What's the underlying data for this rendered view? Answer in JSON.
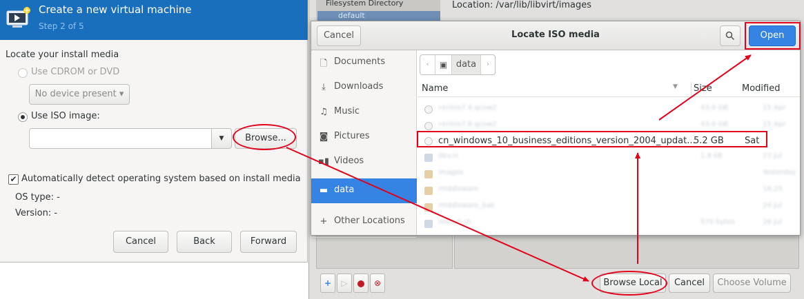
{
  "wizard": {
    "title": "Create a new virtual machine",
    "step": "Step 2 of 5",
    "section_label": "Locate your install media",
    "cdrom_option": "Use CDROM or DVD",
    "cdrom_device": "No device present ▾",
    "iso_option": "Use ISO image:",
    "iso_path": "",
    "browse_button": "Browse...",
    "auto_detect_label": "Automatically detect operating system based on install media",
    "os_type": "OS type: -",
    "version": "Version: -",
    "cancel_button": "Cancel",
    "back_button": "Back",
    "forward_button": "Forward"
  },
  "storage_window": {
    "pool_type": "Filesystem Directory",
    "pool_name": "default",
    "location_label": "Location:",
    "location_path": "/var/lib/libvirt/images",
    "browse_local_button": "Browse Local",
    "cancel_button": "Cancel",
    "choose_volume_button": "Choose Volume"
  },
  "file_chooser": {
    "title": "Locate ISO media",
    "cancel_button": "Cancel",
    "open_button": "Open",
    "places": [
      {
        "label": "Documents",
        "icon": "document-icon"
      },
      {
        "label": "Downloads",
        "icon": "download-icon"
      },
      {
        "label": "Music",
        "icon": "music-icon"
      },
      {
        "label": "Pictures",
        "icon": "camera-icon"
      },
      {
        "label": "Videos",
        "icon": "video-icon"
      },
      {
        "label": "data",
        "icon": "folder-icon"
      },
      {
        "label": "Other Locations",
        "icon": "plus-icon"
      }
    ],
    "path_segment": "data",
    "columns": {
      "name": "Name",
      "size": "Size",
      "modified": "Modified"
    },
    "files": [
      {
        "name": "centos7.4.qcow2",
        "size": "43.0 GB",
        "modified": "15 Apr",
        "icon": "file",
        "blurred": true
      },
      {
        "name": "centos7.6.qcow2",
        "size": "43.0 GB",
        "modified": "15 Apr",
        "icon": "file",
        "blurred": true
      },
      {
        "name": "cn_windows_10_business_editions_version_2004_updat...",
        "size": "5.2 GB",
        "modified": "Sat",
        "icon": "file",
        "blurred": false
      },
      {
        "name": "dev.rc",
        "size": "1.8 kB",
        "modified": "23 Jul",
        "icon": "doc",
        "blurred": true
      },
      {
        "name": "images",
        "size": "",
        "modified": "Yesterday",
        "icon": "folder",
        "blurred": true
      },
      {
        "name": "middleware",
        "size": "",
        "modified": "16:25",
        "icon": "folder",
        "blurred": true
      },
      {
        "name": "middleware_bak",
        "size": "",
        "modified": "24 Jul",
        "icon": "folder",
        "blurred": true
      },
      {
        "name": "restart.sh",
        "size": "570 bytes",
        "modified": "26 Jul",
        "icon": "doc",
        "blurred": true
      }
    ]
  },
  "colors": {
    "accent": "#3584e4",
    "header_blue": "#1a6fbd",
    "annotation_red": "#e3001b"
  }
}
